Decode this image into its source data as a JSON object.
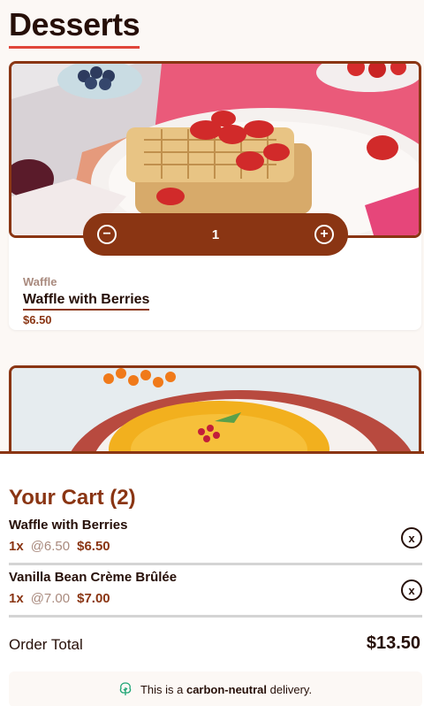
{
  "page": {
    "title": "Desserts"
  },
  "products": [
    {
      "category": "Waffle",
      "name": "Waffle with Berries",
      "price": "$6.50",
      "quantity": "1",
      "image_icon": "waffle-photo"
    },
    {
      "category": "",
      "name": "",
      "price": "",
      "image_icon": "creme-brulee-photo"
    }
  ],
  "cart": {
    "title": "Your Cart (2)",
    "items": [
      {
        "name": "Waffle with Berries",
        "qty": "1x",
        "unit": "@6.50",
        "total": "$6.50"
      },
      {
        "name": "Vanilla Bean Crème Brûlée",
        "qty": "1x",
        "unit": "@7.00",
        "total": "$7.00"
      }
    ],
    "order_total_label": "Order Total",
    "order_total_value": "$13.50",
    "carbon_prefix": "This is a",
    "carbon_bold": "carbon-neutral",
    "carbon_suffix": "delivery.",
    "remove_glyph": "x"
  },
  "colors": {
    "accent": "#8a3513",
    "underline": "#e0453a",
    "background": "#fcf8f5"
  }
}
